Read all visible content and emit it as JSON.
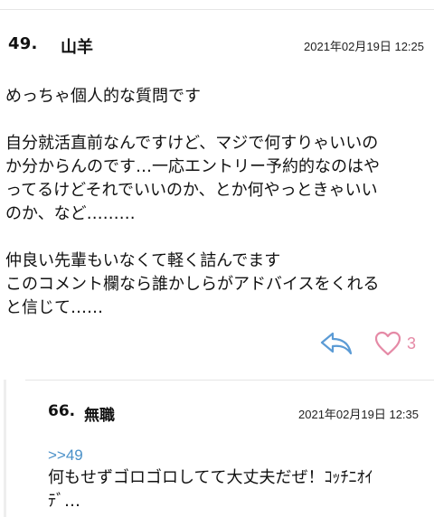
{
  "post": {
    "number": "49.",
    "name": "山羊",
    "date": "2021年02月19日 12:25",
    "body_lines": [
      "めっちゃ個人的な質問です",
      "",
      "自分就活直前なんですけど、マジで何すりゃいいの",
      "か分からんのです…一応エントリー予約的なのはや",
      "ってるけどそれでいいのか、とか何やっときゃいい",
      "のか、など………",
      "",
      "仲良い先輩もいなくて軽く詰んでます",
      "このコメント欄なら誰かしらがアドバイスをくれる",
      "と信じて……"
    ],
    "like_count": "3"
  },
  "reply": {
    "number": "66.",
    "name": "無職",
    "date": "2021年02月19日 12:35",
    "anchor": ">>49",
    "body_lines": [
      "何もせずゴロゴロしてて大丈夫だぜ！ｺｯﾁﾆｵｲ",
      "ﾃﾞ…"
    ]
  },
  "colors": {
    "reply_icon": "#5b9bd5",
    "like_icon": "#e58aa6",
    "anchor": "#4a90c8"
  },
  "icons": {
    "reply": "reply-arrow-icon",
    "like": "heart-outline-icon"
  }
}
